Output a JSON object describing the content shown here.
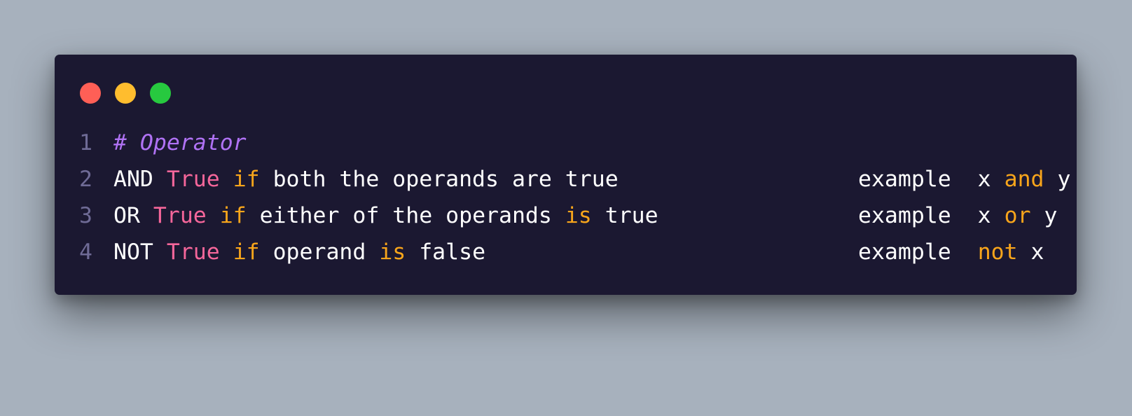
{
  "colors": {
    "background": "#a7b1bd",
    "editor_background": "#1b1831",
    "text": "#ffffff",
    "line_number": "#6f6b96",
    "comment": "#b072f5",
    "constant": "#f5669a",
    "keyword": "#f8a51b",
    "dot_close": "#ff5f56",
    "dot_minimize": "#ffbd2e",
    "dot_maximize": "#27c93f"
  },
  "window_controls": [
    "close-dot",
    "minimize-dot",
    "maximize-dot"
  ],
  "lines": [
    {
      "number": "1",
      "tokens": [
        {
          "text": "# Operator",
          "style": "comment"
        }
      ],
      "example": []
    },
    {
      "number": "2",
      "tokens": [
        {
          "text": "AND ",
          "style": "text"
        },
        {
          "text": "True",
          "style": "constant"
        },
        {
          "text": " ",
          "style": "text"
        },
        {
          "text": "if",
          "style": "keyword"
        },
        {
          "text": " both the operands are true",
          "style": "text"
        }
      ],
      "example": [
        {
          "text": "example  x ",
          "style": "text"
        },
        {
          "text": "and",
          "style": "keyword"
        },
        {
          "text": " y",
          "style": "text"
        }
      ]
    },
    {
      "number": "3",
      "tokens": [
        {
          "text": "OR ",
          "style": "text"
        },
        {
          "text": "True",
          "style": "constant"
        },
        {
          "text": " ",
          "style": "text"
        },
        {
          "text": "if",
          "style": "keyword"
        },
        {
          "text": " either of the operands ",
          "style": "text"
        },
        {
          "text": "is",
          "style": "keyword"
        },
        {
          "text": " true",
          "style": "text"
        }
      ],
      "example": [
        {
          "text": "example  x ",
          "style": "text"
        },
        {
          "text": "or",
          "style": "keyword"
        },
        {
          "text": " y",
          "style": "text"
        }
      ]
    },
    {
      "number": "4",
      "tokens": [
        {
          "text": "NOT ",
          "style": "text"
        },
        {
          "text": "True",
          "style": "constant"
        },
        {
          "text": " ",
          "style": "text"
        },
        {
          "text": "if",
          "style": "keyword"
        },
        {
          "text": " operand ",
          "style": "text"
        },
        {
          "text": "is",
          "style": "keyword"
        },
        {
          "text": " false",
          "style": "text"
        }
      ],
      "example": [
        {
          "text": "example  ",
          "style": "text"
        },
        {
          "text": "not",
          "style": "keyword"
        },
        {
          "text": " x",
          "style": "text"
        }
      ]
    }
  ]
}
